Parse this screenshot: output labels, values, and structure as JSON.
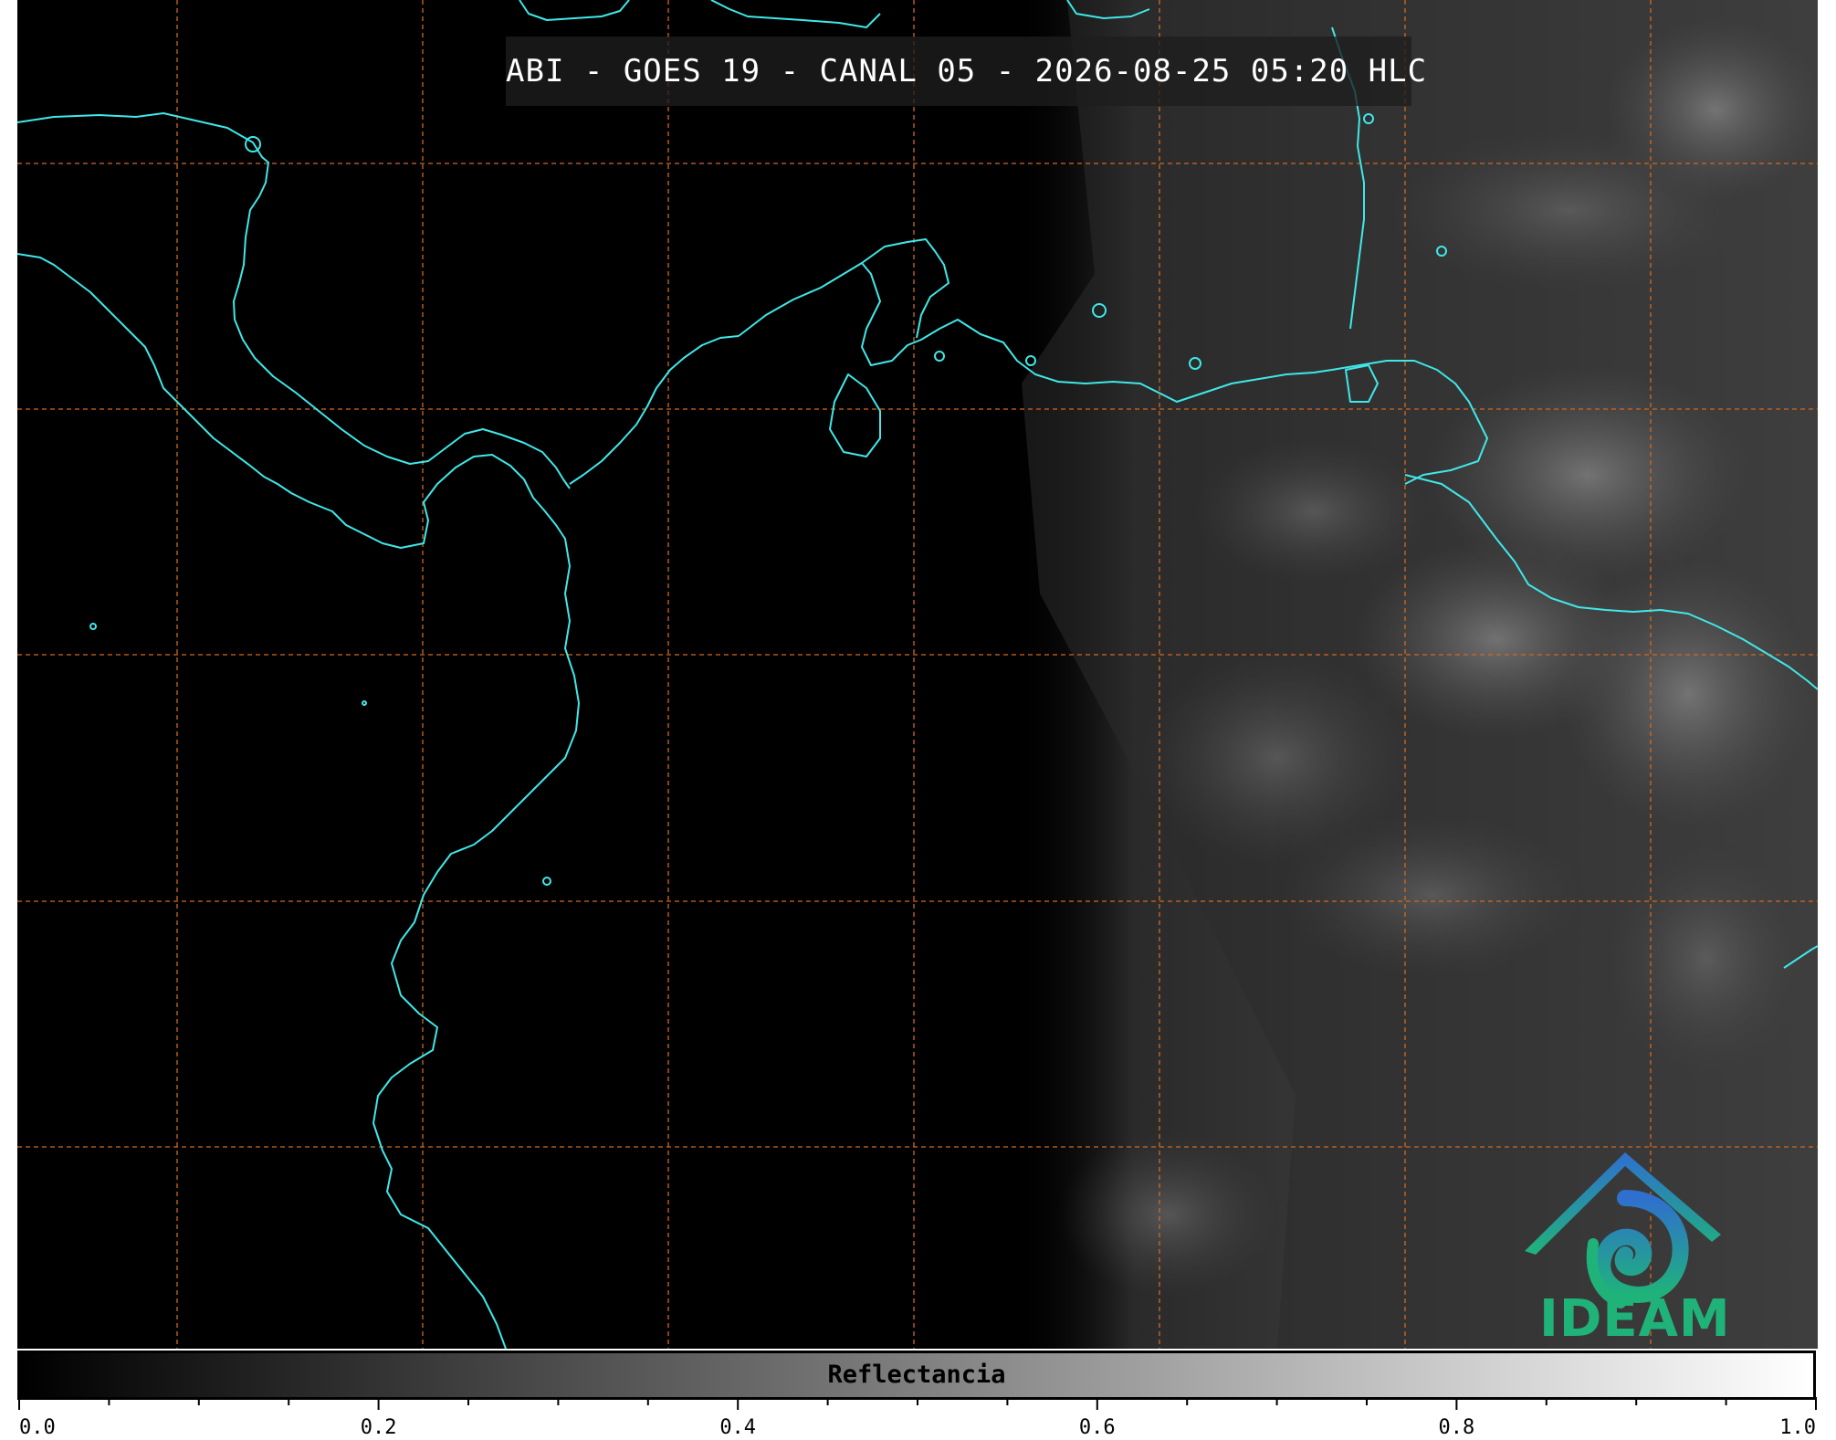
{
  "title": "ABI - GOES 19 - CANAL 05 - 2026-08-25 05:20 HLC",
  "logo": {
    "text": "IDEAM"
  },
  "colorbar": {
    "label": "Reflectancia",
    "ticks": [
      "0.0",
      "0.2",
      "0.4",
      "0.6",
      "0.8",
      "1.0"
    ],
    "min": 0.0,
    "max": 1.0,
    "colors": [
      "#000000",
      "#ffffff"
    ]
  },
  "map": {
    "background": "#000000",
    "coastline_color": "#40e8e8",
    "grid_color": "#d2691e",
    "gridlines": "dashed"
  }
}
